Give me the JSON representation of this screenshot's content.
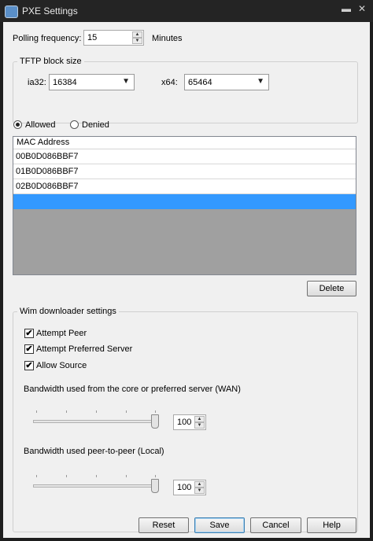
{
  "window": {
    "title": "PXE Settings",
    "minimize_glyph": "▬",
    "close_glyph": "✕",
    "app_icon": "network-icon"
  },
  "polling": {
    "label": "Polling frequency:",
    "value": "15",
    "unit": "Minutes"
  },
  "tftp": {
    "title": "TFTP block size",
    "ia32": {
      "label": "ia32:",
      "value": "16384"
    },
    "x64": {
      "label": "x64:",
      "value": "65464"
    }
  },
  "filter": {
    "allowed_label": "Allowed",
    "denied_label": "Denied",
    "selected": "Allowed"
  },
  "mac_list": {
    "header": "MAC Address",
    "rows": [
      "00B0D086BBF7",
      "01B0D086BBF7",
      "02B0D086BBF7",
      ""
    ],
    "selected_color": "#3399ff"
  },
  "delete_label": "Delete",
  "wim": {
    "title": "Wim downloader settings",
    "attempt_peer": {
      "label": "Attempt Peer",
      "checked": true
    },
    "attempt_preferred": {
      "label": "Attempt Preferred Server",
      "checked": true
    },
    "allow_source": {
      "label": "Allow Source",
      "checked": true
    },
    "wan": {
      "label": "Bandwidth used from the core or preferred server (WAN)",
      "value": "100",
      "level": 1.0
    },
    "local": {
      "label": "Bandwidth used peer-to-peer (Local)",
      "value": "100",
      "level": 1.0
    },
    "check_glyph": "✔"
  },
  "buttons": {
    "reset": "Reset",
    "save": "Save",
    "cancel": "Cancel",
    "help": "Help"
  }
}
